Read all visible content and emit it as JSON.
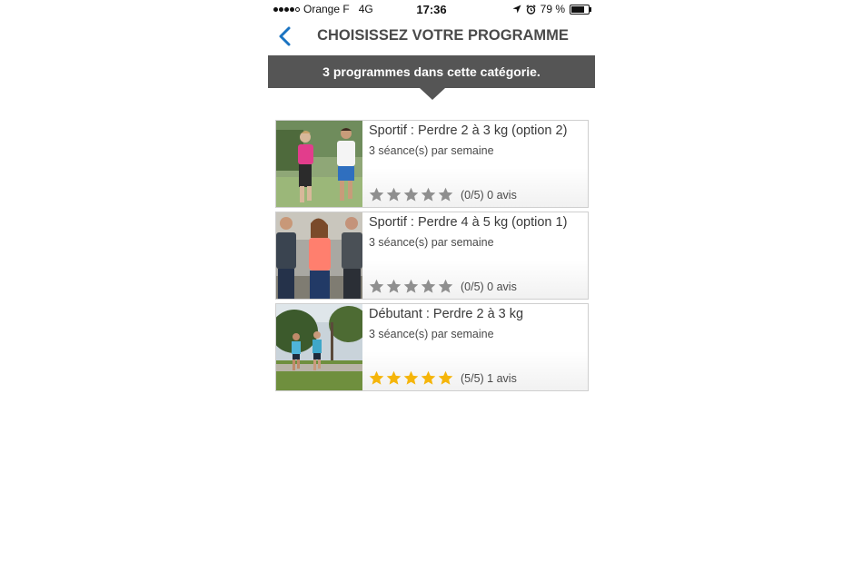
{
  "status_bar": {
    "carrier": "Orange F",
    "network": "4G",
    "time": "17:36",
    "battery": "79 %",
    "battery_level": 0.79
  },
  "nav": {
    "title": "CHOISISSEZ VOTRE PROGRAMME",
    "back_icon": "chevron-left-icon"
  },
  "banner": {
    "text": "3 programmes dans cette catégorie."
  },
  "programs": [
    {
      "title": "Sportif : Perdre 2 à 3 kg (option 2)",
      "subtitle": "3 séance(s) par semaine",
      "stars": 0,
      "rating_text": "(0/5) 0 avis"
    },
    {
      "title": "Sportif : Perdre 4 à 5 kg (option 1)",
      "subtitle": "3 séance(s) par semaine",
      "stars": 0,
      "rating_text": "(0/5) 0 avis"
    },
    {
      "title": "Débutant : Perdre 2 à 3 kg",
      "subtitle": "3 séance(s) par semaine",
      "stars": 5,
      "rating_text": "(5/5) 1 avis"
    }
  ],
  "colors": {
    "accent": "#1a73c1",
    "banner_bg": "#555555",
    "star_on": "#f5b50a",
    "star_off": "#8f8f8f"
  }
}
